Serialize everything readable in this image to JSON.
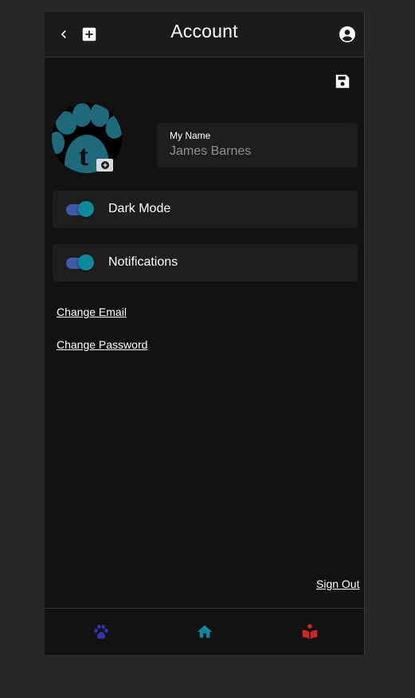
{
  "header": {
    "title": "Account",
    "back_icon": "chevron-left-icon",
    "add_icon": "plus-box-icon",
    "profile_icon": "account-circle-icon"
  },
  "profile": {
    "save_icon": "floppy-disk-icon",
    "avatar_letter": "t",
    "camera_icon": "camera-icon",
    "name_label": "My Name",
    "name_value": "James Barnes"
  },
  "settings": [
    {
      "label": "Dark Mode",
      "enabled": true
    },
    {
      "label": "Notifications",
      "enabled": true
    }
  ],
  "links": {
    "change_email": "Change Email",
    "change_password": "Change Password",
    "sign_out": "Sign Out"
  },
  "bottom_nav": [
    {
      "icon": "paw-icon",
      "color": "#3535a8"
    },
    {
      "icon": "home-icon",
      "color": "#0b8b9a"
    },
    {
      "icon": "book-reader-icon",
      "color": "#c62828"
    }
  ],
  "colors": {
    "accent_teal": "#0b8b9a",
    "switch_track": "#3f5aa8",
    "background": "#121212"
  }
}
